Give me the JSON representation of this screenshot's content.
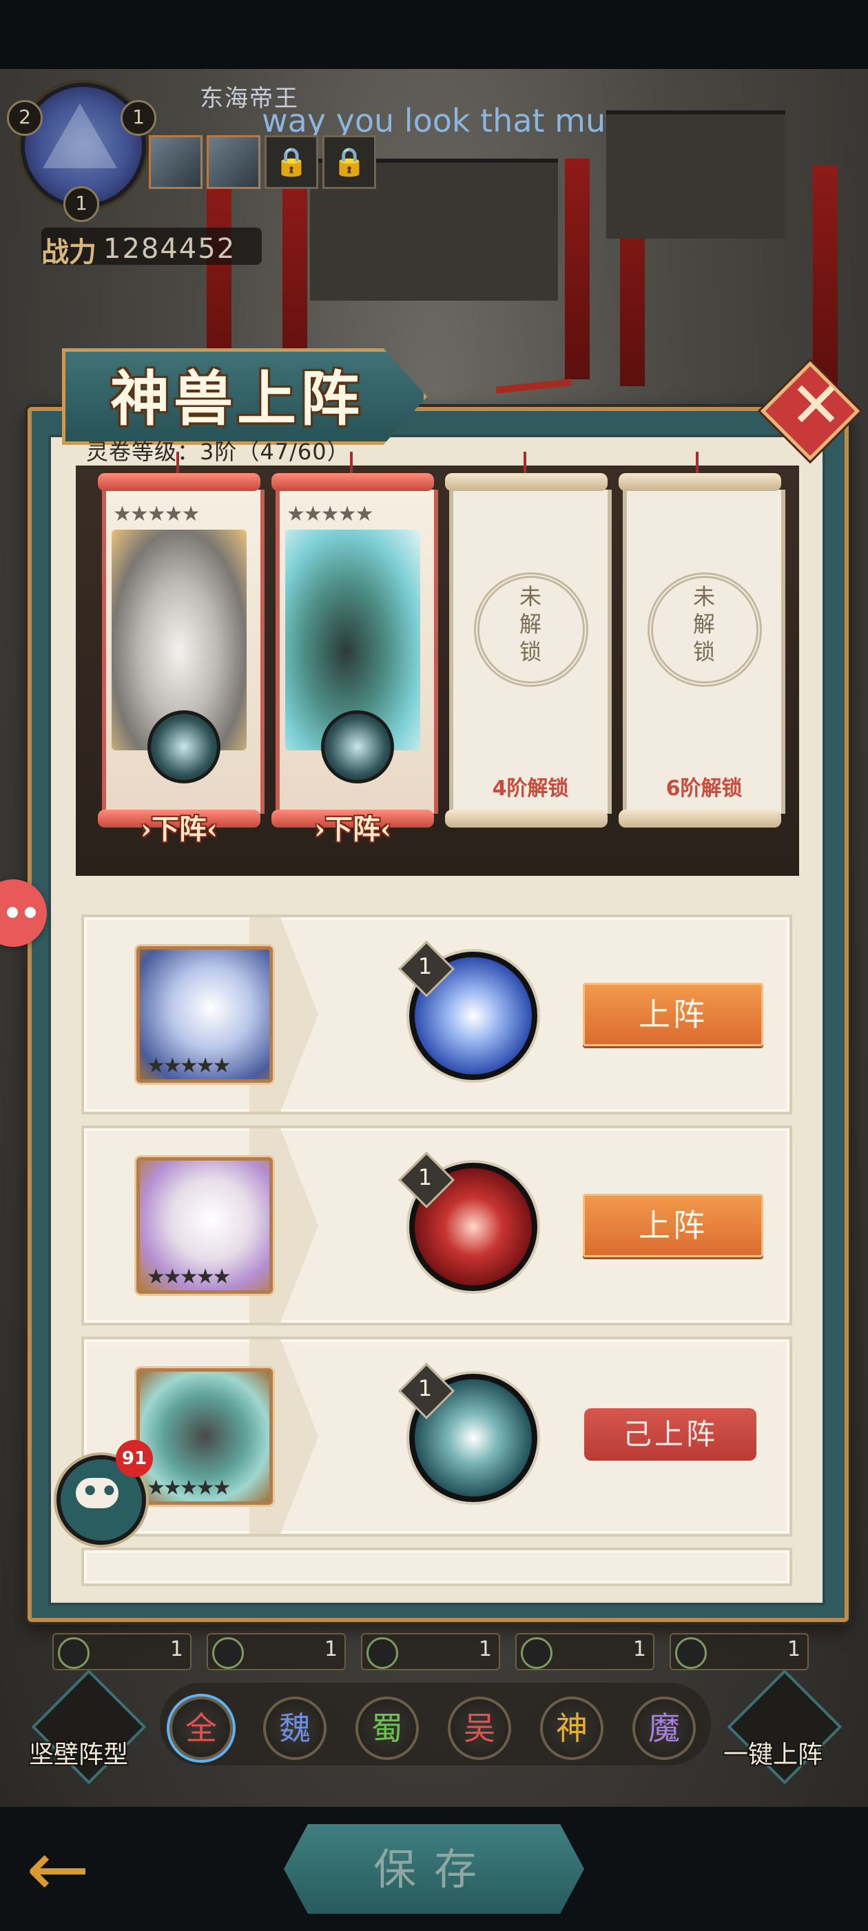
{
  "hud": {
    "player_name": "东海帝王",
    "marquee_text": "way you look that mu",
    "emblem_badges": [
      "2",
      "1",
      "1"
    ],
    "power_label": "战力",
    "power_value": "1284452",
    "lock_icon": "🔒"
  },
  "dialog": {
    "title": "神兽上阵",
    "close_symbol": "✕",
    "scroll_level": "灵卷等级：3阶（47/60）"
  },
  "scroll_slots": [
    {
      "stars": "★★★★★",
      "down_label": "›下阵‹"
    },
    {
      "stars": "★★★★★",
      "down_label": "›下阵‹"
    },
    {
      "lock_text": "未解锁",
      "unlock_cond": "4阶解锁"
    },
    {
      "lock_text": "未解锁",
      "unlock_cond": "6阶解锁"
    }
  ],
  "beasts": [
    {
      "stars": "★★★★★",
      "skill_level": "1",
      "action": "上阵"
    },
    {
      "stars": "★★★★★",
      "skill_level": "1",
      "action": "上阵"
    },
    {
      "stars": "★★★★★",
      "skill_level": "1",
      "action": "己上阵"
    }
  ],
  "chat": {
    "dots": "•••",
    "badge": "91"
  },
  "summary_counts": [
    "1",
    "1",
    "1",
    "1",
    "1"
  ],
  "factions": [
    {
      "label": "全",
      "color": "#e0534e"
    },
    {
      "label": "魏",
      "color": "#6f8fe0"
    },
    {
      "label": "蜀",
      "color": "#69c34e"
    },
    {
      "label": "吴",
      "color": "#e0534e"
    },
    {
      "label": "神",
      "color": "#e6b030"
    },
    {
      "label": "魔",
      "color": "#a880e0"
    }
  ],
  "side_buttons": {
    "left": "坚壁阵型",
    "right": "一键上阵"
  },
  "footer": {
    "back_symbol": "←",
    "save_label": "保存"
  }
}
